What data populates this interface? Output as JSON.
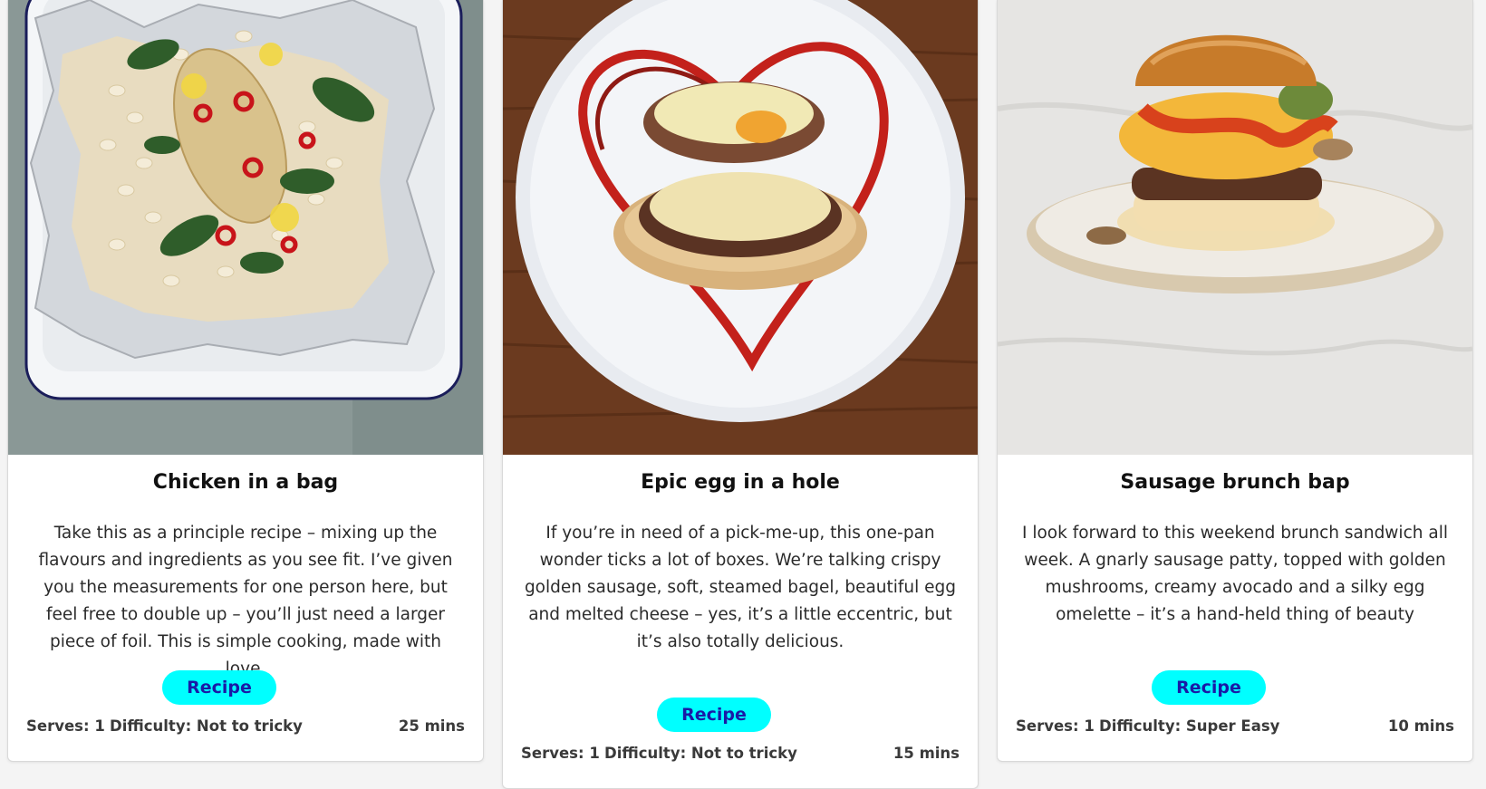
{
  "cards": [
    {
      "title": "Chicken in a bag",
      "image_icon": "chicken-foil-photo",
      "description": "Take this as a principle recipe – mixing up the flavours and ingredients as you see fit. I’ve given you the measurements for one person here, but feel free to double up – you’ll just need a larger piece of foil. This is simple cooking, made with love.",
      "button_label": "Recipe",
      "serves": "Serves: 1",
      "difficulty": "Difficulty: Not to tricky",
      "time": "25 mins"
    },
    {
      "title": "Epic egg in a hole",
      "image_icon": "egg-bagel-photo",
      "description": "If you’re in need of a pick-me-up, this one-pan wonder ticks a lot of boxes. We’re talking crispy golden sausage, soft, steamed bagel, beautiful egg and melted cheese – yes, it’s a little eccentric, but it’s also totally delicious.",
      "button_label": "Recipe",
      "serves": "Serves: 1",
      "difficulty": "Difficulty: Not to tricky",
      "time": "15 mins"
    },
    {
      "title": "Sausage brunch bap",
      "image_icon": "brunch-bap-photo",
      "description": "I look forward to this weekend brunch sandwich all week. A gnarly sausage patty, topped with golden mushrooms, creamy avocado and a silky egg omelette – it’s a hand-held thing of beauty",
      "button_label": "Recipe",
      "serves": "Serves: 1",
      "difficulty": "Difficulty: Super Easy",
      "time": "10 mins"
    }
  ],
  "colors": {
    "button_bg": "#00ffff",
    "button_text": "#1a1aa6",
    "card_bg": "#ffffff"
  }
}
